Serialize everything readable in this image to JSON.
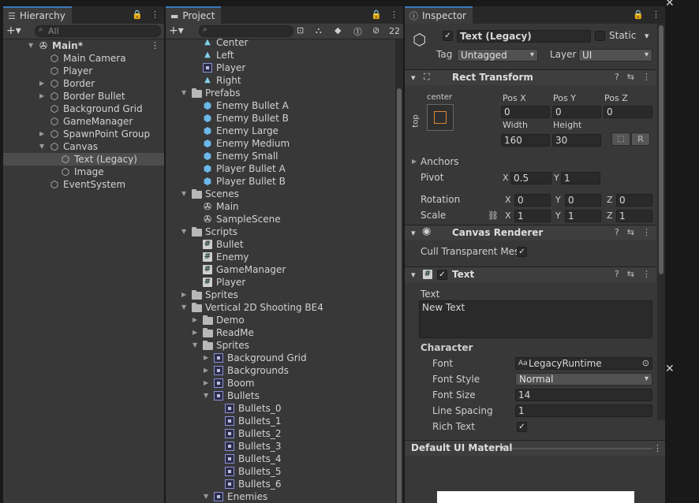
{
  "hierarchy": {
    "tab_label": "Hierarchy",
    "search_placeholder": "All",
    "items": [
      {
        "label": "Main*",
        "depth": 0,
        "icon": "unity-scene-icon",
        "arrow": "down",
        "bold": true
      },
      {
        "label": "Main Camera",
        "depth": 1,
        "icon": "cube-icon",
        "arrow": ""
      },
      {
        "label": "Player",
        "depth": 1,
        "icon": "cube-icon",
        "arrow": ""
      },
      {
        "label": "Border",
        "depth": 1,
        "icon": "cube-icon",
        "arrow": "right"
      },
      {
        "label": "Border Bullet",
        "depth": 1,
        "icon": "cube-icon",
        "arrow": "right"
      },
      {
        "label": "Background Grid",
        "depth": 1,
        "icon": "cube-icon",
        "arrow": ""
      },
      {
        "label": "GameManager",
        "depth": 1,
        "icon": "cube-icon",
        "arrow": ""
      },
      {
        "label": "SpawnPoint Group",
        "depth": 1,
        "icon": "cube-icon",
        "arrow": "right"
      },
      {
        "label": "Canvas",
        "depth": 1,
        "icon": "cube-icon",
        "arrow": "down"
      },
      {
        "label": "Text (Legacy)",
        "depth": 2,
        "icon": "cube-icon",
        "arrow": "",
        "selected": true
      },
      {
        "label": "Image",
        "depth": 2,
        "icon": "cube-icon",
        "arrow": ""
      },
      {
        "label": "EventSystem",
        "depth": 1,
        "icon": "cube-icon",
        "arrow": ""
      }
    ]
  },
  "project": {
    "tab_label": "Project",
    "hidden_count": "22",
    "items": [
      {
        "label": "Center",
        "depth": 2,
        "icon": "tri-icon",
        "arrow": ""
      },
      {
        "label": "Left",
        "depth": 2,
        "icon": "tri-icon",
        "arrow": ""
      },
      {
        "label": "Player",
        "depth": 2,
        "icon": "sprite-icon",
        "arrow": ""
      },
      {
        "label": "Right",
        "depth": 2,
        "icon": "tri-icon",
        "arrow": ""
      },
      {
        "label": "Prefabs",
        "depth": 1,
        "icon": "folder-icon",
        "arrow": "down"
      },
      {
        "label": "Enemy Bullet A",
        "depth": 2,
        "icon": "prefab-icon",
        "arrow": ""
      },
      {
        "label": "Enemy Bullet B",
        "depth": 2,
        "icon": "prefab-icon",
        "arrow": ""
      },
      {
        "label": "Enemy Large",
        "depth": 2,
        "icon": "prefab-icon",
        "arrow": ""
      },
      {
        "label": "Enemy Medium",
        "depth": 2,
        "icon": "prefab-icon",
        "arrow": ""
      },
      {
        "label": "Enemy Small",
        "depth": 2,
        "icon": "prefab-icon",
        "arrow": ""
      },
      {
        "label": "Player Bullet A",
        "depth": 2,
        "icon": "prefab-icon",
        "arrow": ""
      },
      {
        "label": "Player Bullet B",
        "depth": 2,
        "icon": "prefab-icon",
        "arrow": ""
      },
      {
        "label": "Scenes",
        "depth": 1,
        "icon": "folder-icon",
        "arrow": "down"
      },
      {
        "label": "Main",
        "depth": 2,
        "icon": "unity-scene-icon",
        "arrow": ""
      },
      {
        "label": "SampleScene",
        "depth": 2,
        "icon": "unity-scene-icon",
        "arrow": ""
      },
      {
        "label": "Scripts",
        "depth": 1,
        "icon": "folder-icon",
        "arrow": "down"
      },
      {
        "label": "Bullet",
        "depth": 2,
        "icon": "script-icon",
        "arrow": ""
      },
      {
        "label": "Enemy",
        "depth": 2,
        "icon": "script-icon",
        "arrow": ""
      },
      {
        "label": "GameManager",
        "depth": 2,
        "icon": "script-icon",
        "arrow": ""
      },
      {
        "label": "Player",
        "depth": 2,
        "icon": "script-icon",
        "arrow": ""
      },
      {
        "label": "Sprites",
        "depth": 1,
        "icon": "folder-icon",
        "arrow": "right"
      },
      {
        "label": "Vertical 2D Shooting BE4",
        "depth": 1,
        "icon": "folder-icon",
        "arrow": "down"
      },
      {
        "label": "Demo",
        "depth": 2,
        "icon": "folder-icon",
        "arrow": "right"
      },
      {
        "label": "ReadMe",
        "depth": 2,
        "icon": "folder-icon",
        "arrow": "right"
      },
      {
        "label": "Sprites",
        "depth": 2,
        "icon": "folder-icon",
        "arrow": "down"
      },
      {
        "label": "Background Grid",
        "depth": 3,
        "icon": "sprite-icon",
        "arrow": "right"
      },
      {
        "label": "Backgrounds",
        "depth": 3,
        "icon": "sprite-icon",
        "arrow": "right"
      },
      {
        "label": "Boom",
        "depth": 3,
        "icon": "sprite-icon",
        "arrow": "right"
      },
      {
        "label": "Bullets",
        "depth": 3,
        "icon": "sprite-icon",
        "arrow": "down"
      },
      {
        "label": "Bullets_0",
        "depth": 4,
        "icon": "sprite-icon",
        "arrow": ""
      },
      {
        "label": "Bullets_1",
        "depth": 4,
        "icon": "sprite-icon",
        "arrow": ""
      },
      {
        "label": "Bullets_2",
        "depth": 4,
        "icon": "sprite-icon",
        "arrow": ""
      },
      {
        "label": "Bullets_3",
        "depth": 4,
        "icon": "sprite-icon",
        "arrow": ""
      },
      {
        "label": "Bullets_4",
        "depth": 4,
        "icon": "sprite-icon",
        "arrow": ""
      },
      {
        "label": "Bullets_5",
        "depth": 4,
        "icon": "sprite-icon",
        "arrow": ""
      },
      {
        "label": "Bullets_6",
        "depth": 4,
        "icon": "sprite-icon",
        "arrow": ""
      },
      {
        "label": "Enemies",
        "depth": 3,
        "icon": "sprite-icon",
        "arrow": "down"
      }
    ]
  },
  "inspector": {
    "tab_label": "Inspector",
    "object_name": "Text (Legacy)",
    "static_label": "Static",
    "tag_label": "Tag",
    "tag_value": "Untagged",
    "layer_label": "Layer",
    "layer_value": "UI",
    "rect_transform": {
      "title": "Rect Transform",
      "anchor_h": "center",
      "anchor_v": "top",
      "pos_x_label": "Pos X",
      "pos_x": "0",
      "pos_y_label": "Pos Y",
      "pos_y": "0",
      "pos_z_label": "Pos Z",
      "pos_z": "0",
      "width_label": "Width",
      "width": "160",
      "height_label": "Height",
      "height": "30",
      "r_button": "R",
      "anchors_label": "Anchors",
      "pivot_label": "Pivot",
      "pivot_x": "0.5",
      "pivot_y": "1",
      "rotation_label": "Rotation",
      "rot_x": "0",
      "rot_y": "0",
      "rot_z": "0",
      "scale_label": "Scale",
      "scale_x": "1",
      "scale_y": "1",
      "scale_z": "1",
      "x": "X",
      "y": "Y",
      "z": "Z"
    },
    "canvas_renderer": {
      "title": "Canvas Renderer",
      "cull_label": "Cull Transparent Mes"
    },
    "text": {
      "title": "Text",
      "text_label": "Text",
      "text_value": "New Text",
      "character_label": "Character",
      "font_label": "Font",
      "font_value": "LegacyRuntime",
      "font_style_label": "Font Style",
      "font_style_value": "Normal",
      "font_size_label": "Font Size",
      "font_size_value": "14",
      "line_spacing_label": "Line Spacing",
      "line_spacing_value": "1",
      "rich_text_label": "Rich Text"
    },
    "material_label": "Default UI Material"
  }
}
